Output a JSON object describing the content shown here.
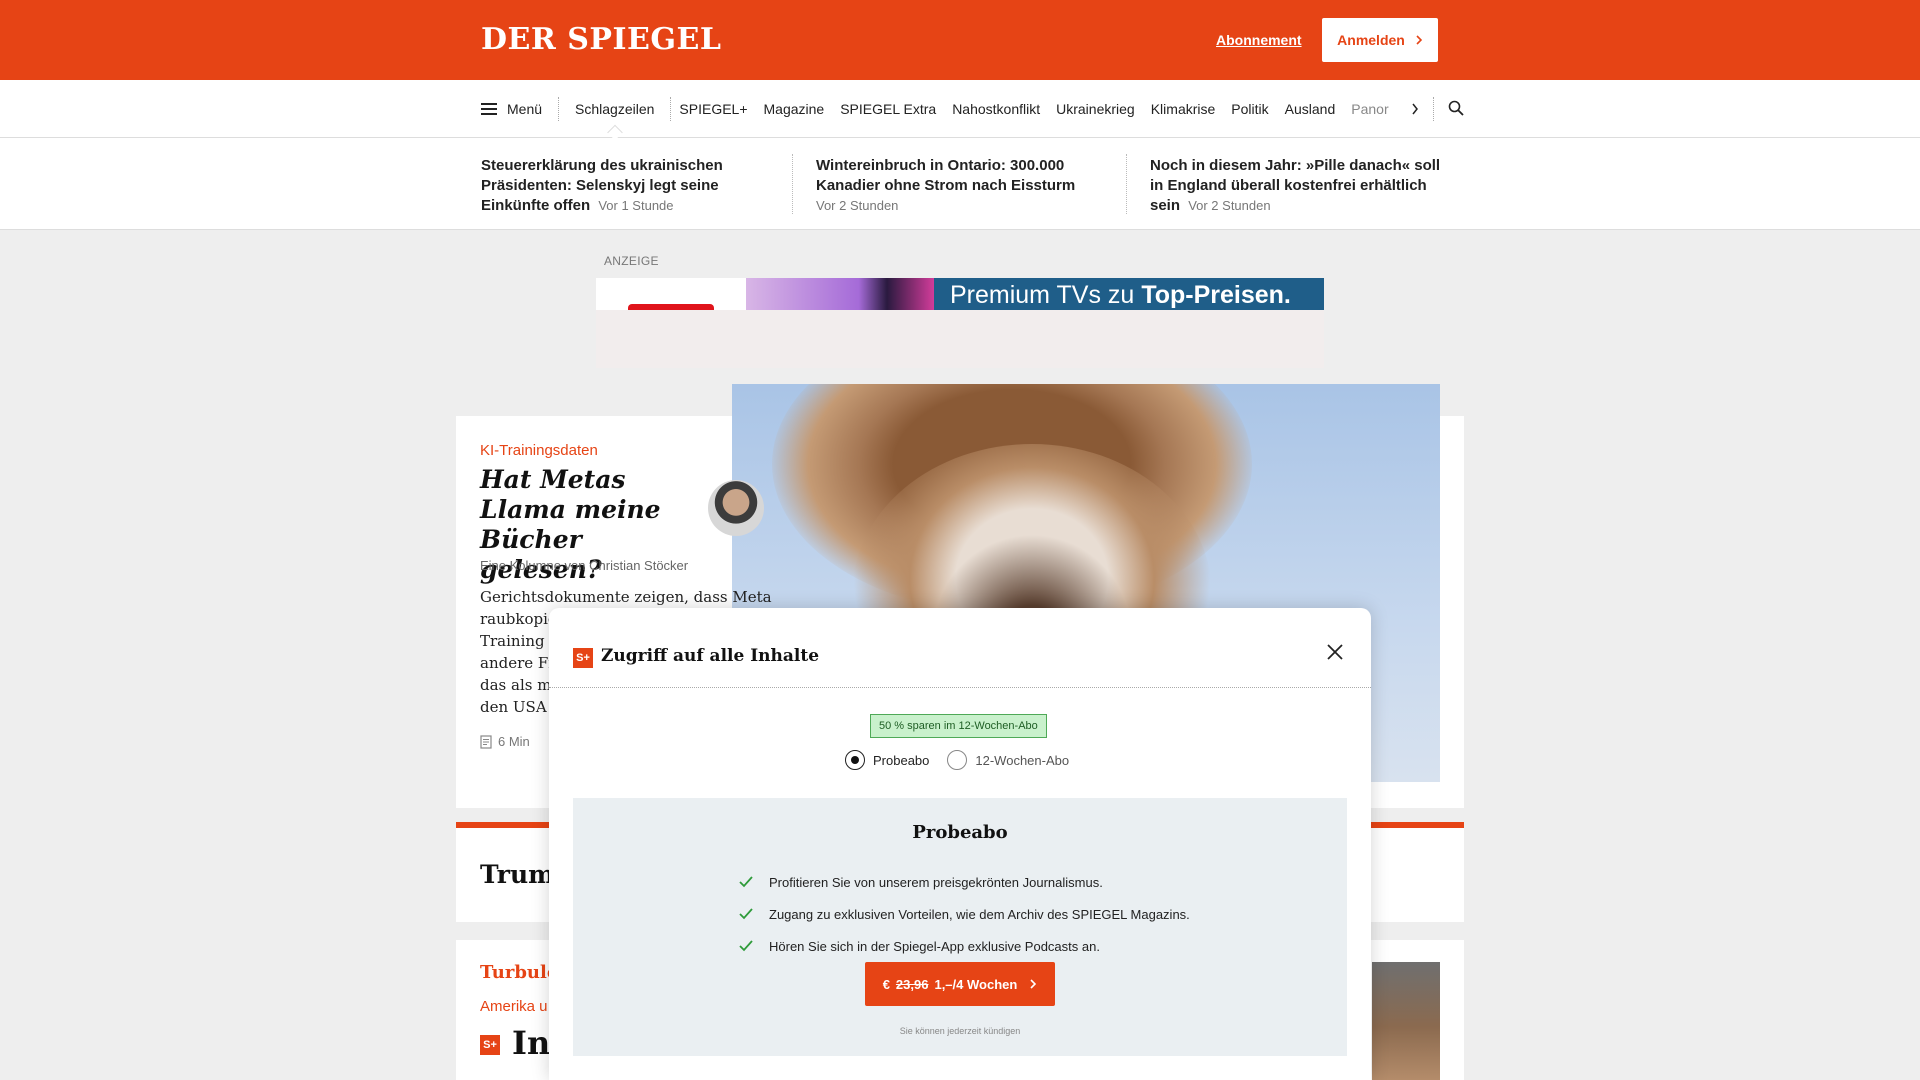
{
  "header": {
    "logo": "DER SPIEGEL",
    "abo_link": "Abonnement",
    "login_label": "Anmelden"
  },
  "nav": {
    "menu_label": "Menü",
    "active_item": "Schlagzeilen",
    "items": [
      "SPIEGEL+",
      "Magazine",
      "SPIEGEL Extra",
      "Nahostkonflikt",
      "Ukrainekrieg",
      "Klimakrise",
      "Politik",
      "Ausland"
    ],
    "faded_item": "Panor"
  },
  "ticker": [
    {
      "headline": "Steuererklärung des ukrainischen Präsidenten: Selenskyj legt seine Einkünfte offen",
      "time": "Vor 1 Stunde"
    },
    {
      "headline": "Wintereinbruch in Ontario: 300.000 Kanadier ohne Strom nach Eissturm",
      "time": "Vor 2 Stunden"
    },
    {
      "headline": "Noch in diesem Jahr: »Pille danach« soll in England überall kostenfrei erhältlich sein",
      "time": "Vor 2 Stunden"
    }
  ],
  "ad": {
    "label": "ANZEIGE",
    "text_regular": "Premium TVs zu",
    "text_bold": "Top-Preisen."
  },
  "teaser": {
    "kicker": "KI-Trainingsdaten",
    "title": "Hat Metas Llama meine Bücher gelesen?",
    "byline": "Eine Kolumne von Christian Stöcker",
    "intro_lines": [
      "Gerichtsdokumente zeigen, dass Meta",
      "raubkopie",
      "Training s",
      "andere Fi",
      "das als mä",
      "den USA"
    ],
    "read_time": "6 Min"
  },
  "trump_teaser": {
    "text": "Trump"
  },
  "bottom_teaser": {
    "kicker": "Turbuler",
    "sub": "Amerika u",
    "badge": "S+",
    "title": "In"
  },
  "modal": {
    "badge": "S+",
    "title": "Zugriff auf alle Inhalte",
    "savings": "50 % sparen im 12-Wochen-Abo",
    "options": [
      "Probeabo",
      "12-Wochen-Abo"
    ],
    "selected_option": "Probeabo",
    "plan_title": "Probeabo",
    "features": [
      "Profitieren Sie von unserem preisgekrönten Journalismus.",
      "Zugang zu exklusiven Vorteilen, wie dem Archiv des SPIEGEL Magazins.",
      "Hören Sie sich in der Spiegel-App exklusive Podcasts an."
    ],
    "cta_prefix": "€",
    "cta_old_price": "23,96",
    "cta_new_price": "1,–/4 Wochen",
    "fine_print": "Sie können jederzeit kündigen"
  },
  "colors": {
    "brand": "#e64415",
    "savings_bg": "#c9f1cc",
    "check": "#2e9b3a"
  },
  "icons": [
    "menu-icon",
    "search-icon",
    "chevron-right-icon",
    "close-icon",
    "check-icon",
    "reading-time-icon"
  ]
}
